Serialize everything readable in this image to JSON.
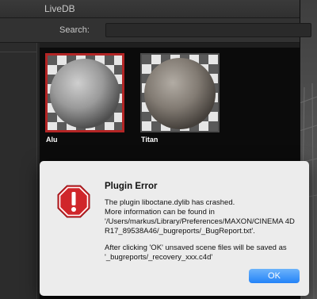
{
  "window": {
    "title": "LiveDB"
  },
  "toolbar": {
    "search_label": "Search:",
    "search_value": ""
  },
  "materials": [
    {
      "name": "Alu",
      "selected": true
    },
    {
      "name": "Titan",
      "selected": false
    }
  ],
  "dialog": {
    "title": "Plugin Error",
    "lines": [
      "The plugin liboctane.dylib has crashed.",
      "More information can be found in",
      "'/Users/markus/Library/Preferences/MAXON/CINEMA 4D",
      "R17_89538A46/_bugreports/_BugReport.txt'.",
      "After clicking 'OK' unsaved scene files will be saved as",
      "'_bugreports/_recovery_xxx.c4d'"
    ],
    "ok_label": "OK",
    "icon": "stop-octagon-icon"
  },
  "colors": {
    "accent_selection": "#b32525",
    "ok_button": "#2483f8",
    "error_icon": "#d0262a"
  }
}
